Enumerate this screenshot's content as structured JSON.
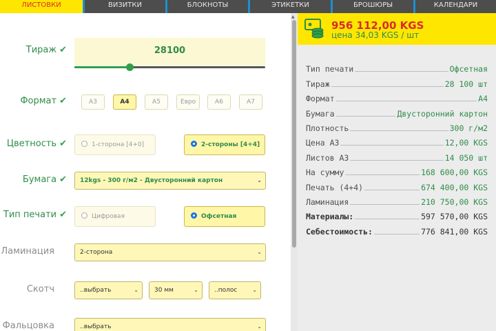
{
  "tabs": [
    "ЛИСТОВКИ",
    "ВИЗИТКИ",
    "БЛОКНОТЫ",
    "ЭТИКЕТКИ",
    "БРОШЮРЫ",
    "КАЛЕНДАРИ"
  ],
  "form": {
    "tirazh": {
      "label": "Тираж",
      "value": "28100",
      "slider_fraction": 0.29
    },
    "format": {
      "label": "Формат",
      "options": [
        "А3",
        "А4",
        "А5",
        "Евро",
        "А6",
        "А7"
      ],
      "selected": "А4"
    },
    "color": {
      "label": "Цветность",
      "options": [
        "1-сторона [4+0]",
        "2-стороны [4+4]"
      ],
      "selected": "2-стороны [4+4]"
    },
    "paper": {
      "label": "Бумага",
      "value": "12kgs - 300 г/м2 - Двусторонний картон"
    },
    "print_type": {
      "label": "Тип печати",
      "options": [
        "Цифровая",
        "Офсетная"
      ],
      "selected": "Офсетная"
    },
    "lamination": {
      "label": "Ламинация",
      "value": "2-сторона"
    },
    "scotch": {
      "label": "Скотч",
      "v1": "..выбрать",
      "v2": "30 мм",
      "v3": "..полос"
    },
    "folding": {
      "label": "Фальцовка",
      "value": "..выбрать"
    }
  },
  "summary": {
    "total": "956 112,00 KGS",
    "unit_price": "цена 34,03 KGS / шт",
    "lines": [
      {
        "label": "Тип печати",
        "value": "Офсетная"
      },
      {
        "label": "Тираж",
        "value": "28 100 шт"
      },
      {
        "label": "Формат",
        "value": "А4"
      },
      {
        "label": "Бумага",
        "value": "Двусторонний картон"
      },
      {
        "label": "Плотность",
        "value": "300 г/м2"
      },
      {
        "label": "Цена А3",
        "value": "12,00 KGS"
      },
      {
        "label": "Листов А3",
        "value": "14 050 шт"
      },
      {
        "label": "На сумму",
        "value": "168 600,00 KGS"
      },
      {
        "label": "Печать (4+4)",
        "value": "674 400,00 KGS"
      },
      {
        "label": "Ламинация",
        "value": "210 750,00 KGS"
      },
      {
        "label": "Материалы:",
        "value": "597 570,00 KGS"
      },
      {
        "label": "Себестоимость:",
        "value": "776 841,00 KGS"
      }
    ]
  },
  "colors": {
    "accent_yellow": "#ffe600",
    "accent_green": "#2f8c4a",
    "accent_red": "#d62c2c",
    "tab_separator": "#1d8fd0"
  }
}
